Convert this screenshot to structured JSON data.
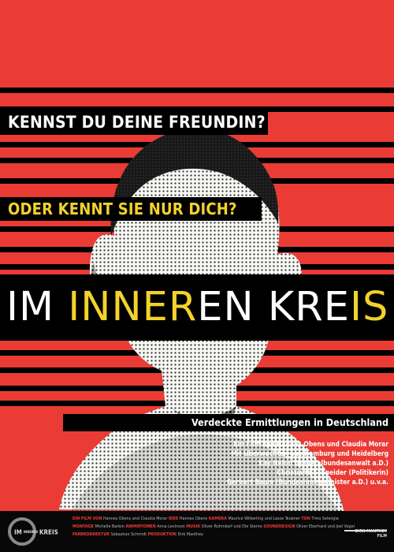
{
  "taglines": {
    "question_one": "KENNST DU DEINE FREUNDIN?",
    "question_two": "ODER KENNT SIE NUR DICH?"
  },
  "title": {
    "part1": "IM ",
    "part2": "INNE",
    "part3": "R",
    "part4": "EN KRE",
    "part5": "IS"
  },
  "subtitle": "Verdeckte Ermittlungen in Deutschland",
  "credits": {
    "line1": "Ein Film von Hannes Obens und Claudia Morar",
    "line2": "Mit Überwachten aus Hamburg und Heidelberg",
    "line3": "Kay Nehm (Generalbundesanwalt a.D.)",
    "line4": "Christiane Schneider (Politikerin)",
    "line5": "Gerhart Baum (Bundesinnenminister a.D.) u.v.a."
  },
  "footer": {
    "logo_im": "IM",
    "logo_small": "INNEREN",
    "logo_kreis": "KREIS",
    "row1": [
      {
        "role": "EIN FILM VON",
        "name": "Hannes Obens and Claudia Morar"
      },
      {
        "role": "IDEE",
        "name": "Hannes Obens"
      },
      {
        "role": "KAMERA",
        "name": "Maurice Wilkerling und Lasse Teubner"
      },
      {
        "role": "TON",
        "name": "Timo Selengia"
      }
    ],
    "row2": [
      {
        "role": "MONTAGE",
        "name": "Michelle Barbin"
      },
      {
        "role": "ANIMATIONEN",
        "name": "Anna Levinson"
      },
      {
        "role": "MUSIK",
        "name": "Oliver Ruhmkorf und Die Sterne"
      },
      {
        "role": "SOUNDDESIGN",
        "name": "Oliver Eberhard und Joel Vogel"
      }
    ],
    "row3": [
      {
        "role": "FARBKORREKTUR",
        "name": "Sebastian Schmidt"
      },
      {
        "role": "PRODUKTION",
        "name": "Dirk Manthey"
      }
    ],
    "distributor": "DIRK MANTHEY FILM"
  },
  "colors": {
    "background": "#ea3b35",
    "accent_yellow": "#f2d22c",
    "black": "#000000"
  },
  "image": {
    "subject": "halftone portrait of a man"
  }
}
